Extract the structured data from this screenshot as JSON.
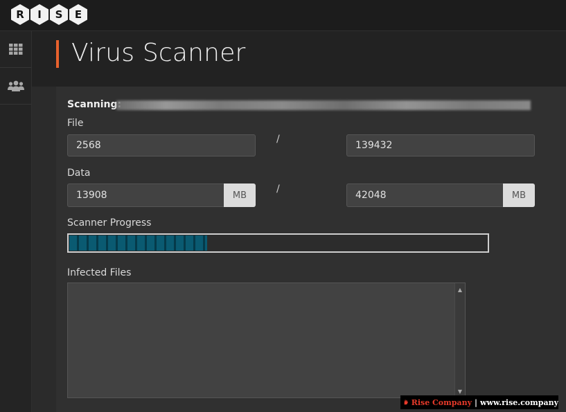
{
  "brand": {
    "logo_letters": [
      "R",
      "I",
      "S",
      "E"
    ]
  },
  "sidebar": {
    "items": [
      {
        "icon": "grid-icon"
      },
      {
        "icon": "users-icon"
      }
    ]
  },
  "page": {
    "title": "Virus Scanner"
  },
  "scan": {
    "scanning_label": "Scanning:",
    "file_label": "File",
    "files_scanned": "2568",
    "files_total": "139432",
    "data_label": "Data",
    "data_scanned": "13908",
    "data_total": "42048",
    "unit": "MB",
    "separator": "/",
    "progress_label": "Scanner Progress",
    "progress_fraction": 0.33,
    "infected_label": "Infected Files"
  },
  "watermark": {
    "company": "Rise Company",
    "separator": "|",
    "url": "www.rise.company"
  },
  "colors": {
    "accent": "#e8622d",
    "progress": "#0a5a71",
    "watermark_red": "#e83a2a"
  }
}
